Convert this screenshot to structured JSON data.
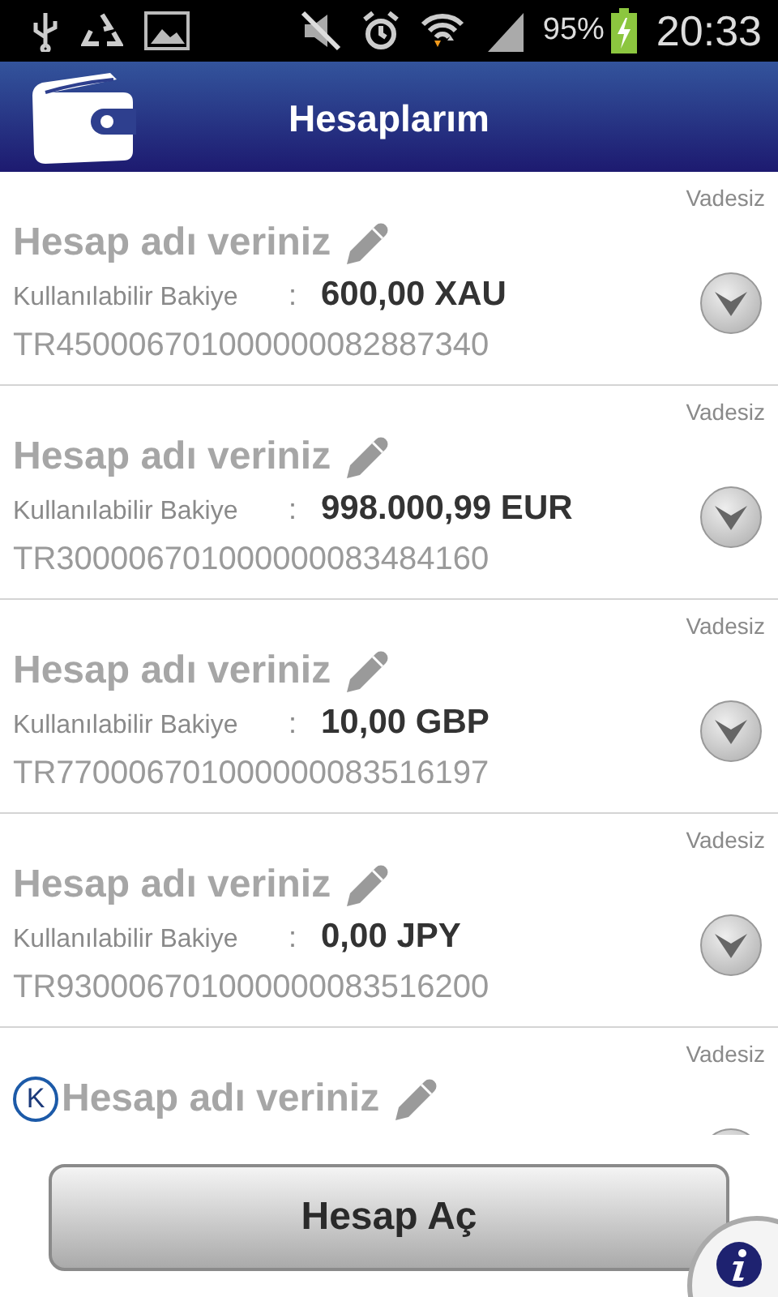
{
  "status_bar": {
    "battery": "95%",
    "time": "20:33"
  },
  "header": {
    "title": "Hesaplarım"
  },
  "accounts": [
    {
      "kind": "full",
      "type": "Vadesiz",
      "name": "Hesap adı veriniz",
      "balance_label": "Kullanılabilir Bakiye",
      "separator": ":",
      "balance": "600,00 XAU",
      "iban": "TR450006701000000082887340"
    },
    {
      "kind": "full",
      "type": "Vadesiz",
      "name": "Hesap adı veriniz",
      "balance_label": "Kullanılabilir Bakiye",
      "separator": ":",
      "balance": "998.000,99 EUR",
      "iban": "TR300006701000000083484160"
    },
    {
      "kind": "full",
      "type": "Vadesiz",
      "name": "Hesap adı veriniz",
      "balance_label": "Kullanılabilir Bakiye",
      "separator": ":",
      "balance": "10,00 GBP",
      "iban": "TR770006701000000083516197"
    },
    {
      "kind": "full",
      "type": "Vadesiz",
      "name": "Hesap adı veriniz",
      "balance_label": "Kullanılabilir Bakiye",
      "separator": ":",
      "balance": "0,00 JPY",
      "iban": "TR930006701000000083516200"
    },
    {
      "kind": "partial",
      "type": "Vadesiz",
      "name": "Hesap adı veriniz",
      "badge": "K"
    }
  ],
  "footer": {
    "button": "Hesap Aç"
  }
}
